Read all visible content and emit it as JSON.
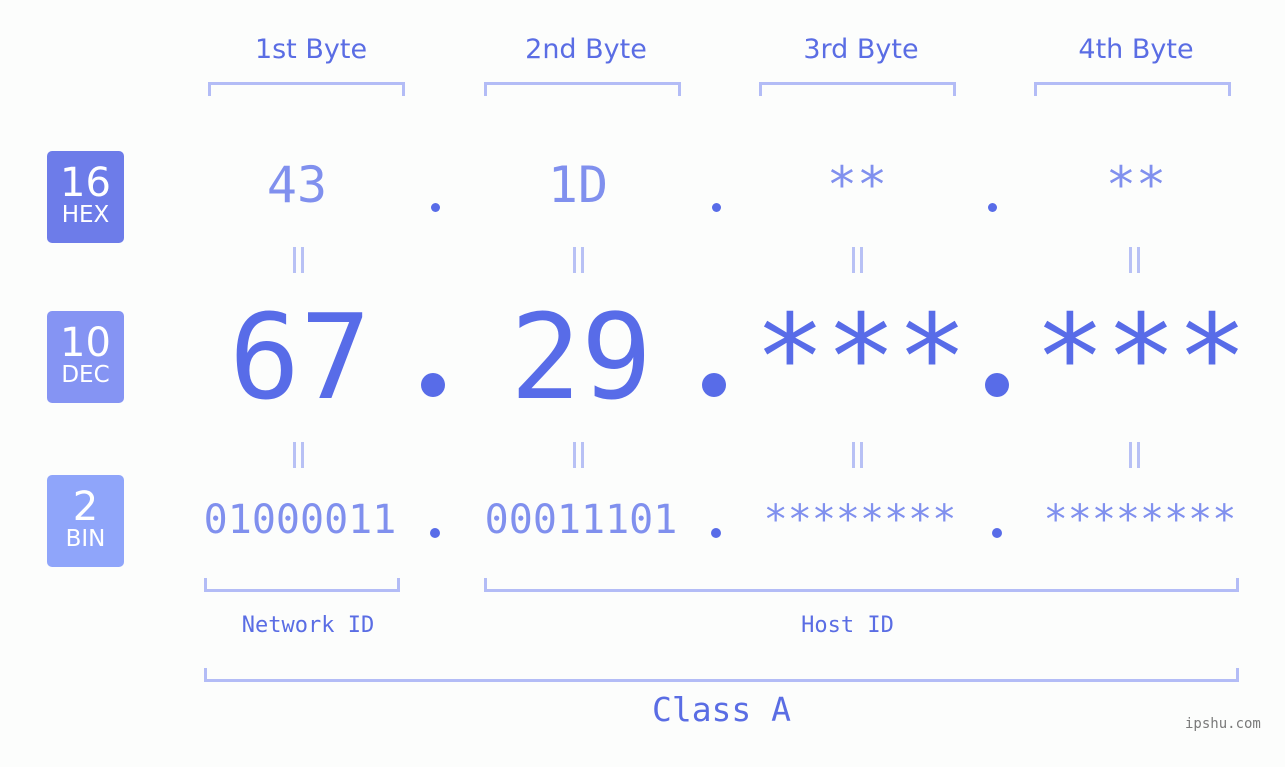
{
  "bases": [
    {
      "num": "16",
      "label": "HEX",
      "color": "#6d7ce9"
    },
    {
      "num": "10",
      "label": "DEC",
      "color": "#8594f3"
    },
    {
      "num": "2",
      "label": "BIN",
      "color": "#8fa5fa"
    }
  ],
  "byte_headers": [
    "1st Byte",
    "2nd Byte",
    "3rd Byte",
    "4th Byte"
  ],
  "hex": [
    "43",
    "1D",
    "**",
    "**"
  ],
  "dec": [
    "67",
    "29",
    "***",
    "***"
  ],
  "bin": [
    "01000011",
    "00011101",
    "********",
    "********"
  ],
  "network_id_label": "Network ID",
  "host_id_label": "Host ID",
  "class_label": "Class A",
  "watermark": "ipshu.com",
  "colors": {
    "primary": "#586ce8",
    "light": "#8090ee",
    "bracket": "#b3bcf6"
  }
}
